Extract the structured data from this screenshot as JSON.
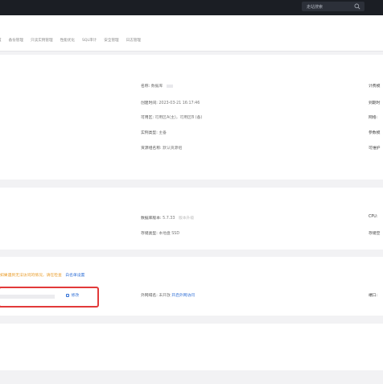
{
  "topbar": {
    "search_placeholder": "走站搜索",
    "search_icon": "search-icon"
  },
  "tabs": [
    {
      "label": "置"
    },
    {
      "label": "备份管理"
    },
    {
      "label": "只读实例管理"
    },
    {
      "label": "性能优化"
    },
    {
      "label": "SQL审计"
    },
    {
      "label": "安全管理"
    },
    {
      "label": "日志管理"
    }
  ],
  "basic": {
    "name_label": "名称:",
    "name_value": "数据库",
    "created_label": "创建时间:",
    "created_value": "2023-03-21 16:17:46",
    "zone_label": "可用区:",
    "zone_value": "可用区A(主)，可用区B (备)",
    "instance_type_label": "实例类型:",
    "instance_type_value": "主备",
    "resource_group_label": "资源组名称:",
    "resource_group_value": "默认资源组",
    "right_1": "计费模",
    "right_2": "到期时",
    "right_3": "网络:",
    "right_4": "参数模",
    "right_5": "可维护"
  },
  "config": {
    "db_version_label": "数据库版本:",
    "db_version_value": "5.7.33",
    "db_version_extra": "版本升级",
    "storage_label": "存储类型:",
    "storage_value": "本地盘 SSD",
    "right_cpu": "CPU:",
    "right_storage": "存储空"
  },
  "connect": {
    "warning": "如果遇到无法访问的情况，请在检查",
    "warning_link": "白名单设置",
    "edit_label": "修改",
    "external_label": "外网域名:",
    "external_status": "未开放",
    "external_link": "开启外网访问",
    "right_port": "端口:"
  }
}
